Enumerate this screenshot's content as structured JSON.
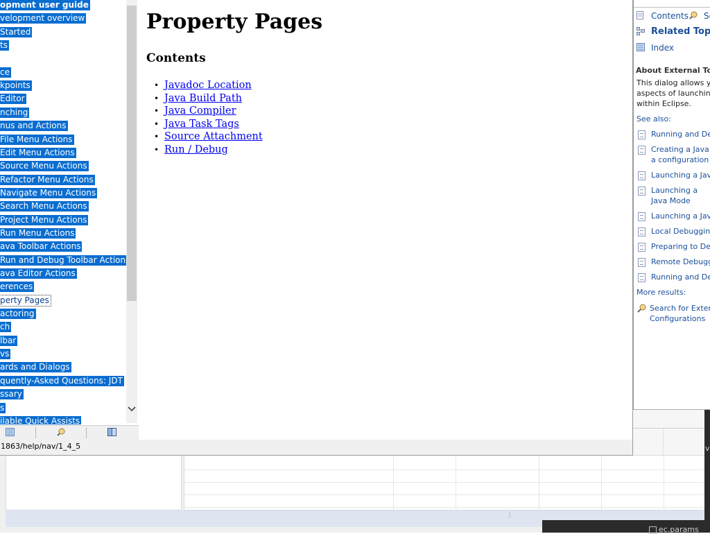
{
  "nav": {
    "toc_items": [
      {
        "label": "opment user guide",
        "bold": true
      },
      {
        "label": "velopment overview"
      },
      {
        "label": "Started"
      },
      {
        "label": "ts"
      },
      {
        "label": ""
      },
      {
        "label": "ce"
      },
      {
        "label": "kpoints"
      },
      {
        "label": "Editor"
      },
      {
        "label": "nching"
      },
      {
        "label": "nus and Actions"
      },
      {
        "label": "File Menu Actions"
      },
      {
        "label": "Edit Menu Actions"
      },
      {
        "label": "Source Menu Actions"
      },
      {
        "label": "Refactor Menu Actions"
      },
      {
        "label": "Navigate Menu Actions"
      },
      {
        "label": "Search Menu Actions"
      },
      {
        "label": "Project Menu Actions"
      },
      {
        "label": "Run Menu Actions"
      },
      {
        "label": "ava Toolbar Actions"
      },
      {
        "label": "Run and Debug Toolbar Actions"
      },
      {
        "label": "ava Editor Actions"
      },
      {
        "label": "erences"
      },
      {
        "label": "perty Pages",
        "current": true
      },
      {
        "label": "actoring"
      },
      {
        "label": "ch"
      },
      {
        "label": "lbar"
      },
      {
        "label": "vs"
      },
      {
        "label": "ards and Dialogs"
      },
      {
        "label": "quently-Asked Questions: JDT"
      },
      {
        "label": "ssary"
      },
      {
        "label": "s"
      },
      {
        "label": "ilable Quick Assists"
      }
    ],
    "tabs": [
      {
        "name": "contents-tab-icon"
      },
      {
        "name": "search-results-tab-icon"
      },
      {
        "name": "bookmarks-tab-icon"
      }
    ]
  },
  "status_url": "1863/help/nav/1_4_5",
  "content": {
    "title": "Property Pages",
    "contents_heading": "Contents",
    "links": [
      "Javadoc Location",
      "Java Build Path",
      "Java Compiler",
      "Java Task Tags",
      "Source Attachment",
      "Run / Debug"
    ]
  },
  "help_view": {
    "contents": "Contents",
    "search_partial": "Se",
    "related_topics": "Related Topics",
    "index": "Index",
    "about_heading": "About External Tool",
    "about_text": "This dialog allows yo aspects of launching within Eclipse.",
    "see_also": "See also:",
    "see_also_links": [
      "Running and De",
      "Creating a Java a configuration",
      "Launching a Java",
      "Launching a Java Mode",
      "Launching a Java",
      "Local Debugging",
      "Preparing to Deb",
      "Remote Debugg",
      "Running and De"
    ],
    "more_results": "More results:",
    "search_for": "Search for Extern Configurations"
  },
  "background": {
    "params_label": "ec.params",
    "dark_letter": "ve"
  }
}
